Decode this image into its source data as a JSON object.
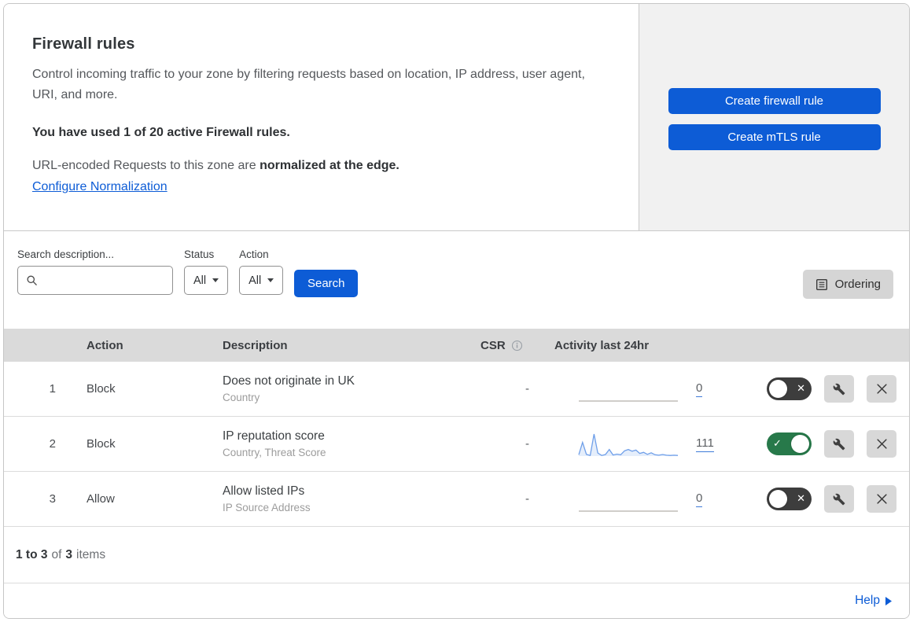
{
  "colors": {
    "primary_blue": "#0d5cd6",
    "toggle_on_green": "#27794a",
    "toggle_off_gray": "#3d3d3d",
    "sparkline_blue": "#6f9fe9",
    "panel_gray": "#f1f1f1",
    "table_header_gray": "#dadada"
  },
  "header": {
    "title": "Firewall rules",
    "description": "Control incoming traffic to your zone by filtering requests based on location, IP address, user agent, URI, and more.",
    "usage": "You have used 1 of 20 active Firewall rules.",
    "normalization_text": "URL-encoded Requests to this zone are",
    "normalization_bold": "normalized at the edge.",
    "normalization_link": "Configure Normalization",
    "buttons": [
      {
        "label": "Create firewall rule"
      },
      {
        "label": "Create mTLS rule"
      }
    ]
  },
  "filters": {
    "search_label": "Search description...",
    "search_placeholder": "",
    "search_value": "",
    "status_label": "Status",
    "status_value": "All",
    "action_label": "Action",
    "action_value": "All",
    "search_button": "Search",
    "ordering_button": "Ordering"
  },
  "table": {
    "columns": {
      "action": "Action",
      "description": "Description",
      "csr": "CSR",
      "activity": "Activity last 24hr"
    },
    "rows": [
      {
        "priority": "1",
        "action": "Block",
        "description": "Does not originate in UK",
        "fields": "Country",
        "csr": "-",
        "activity_count": "0",
        "enabled": false,
        "sparkline": [
          0,
          0
        ]
      },
      {
        "priority": "2",
        "action": "Block",
        "description": "IP reputation score",
        "fields": "Country, Threat Score",
        "csr": "-",
        "activity_count": "111",
        "enabled": true,
        "sparkline": [
          6,
          62,
          8,
          3,
          100,
          14,
          3,
          7,
          30,
          5,
          9,
          6,
          24,
          30,
          22,
          27,
          12,
          17,
          8,
          15,
          6,
          4,
          7,
          4,
          3,
          4,
          3
        ]
      },
      {
        "priority": "3",
        "action": "Allow",
        "description": "Allow listed IPs",
        "fields": "IP Source Address",
        "csr": "-",
        "activity_count": "0",
        "enabled": false,
        "sparkline": [
          0,
          0
        ]
      }
    ]
  },
  "footer": {
    "range": "1 to 3",
    "of": "of",
    "total": "3",
    "items": "items",
    "help": "Help"
  }
}
